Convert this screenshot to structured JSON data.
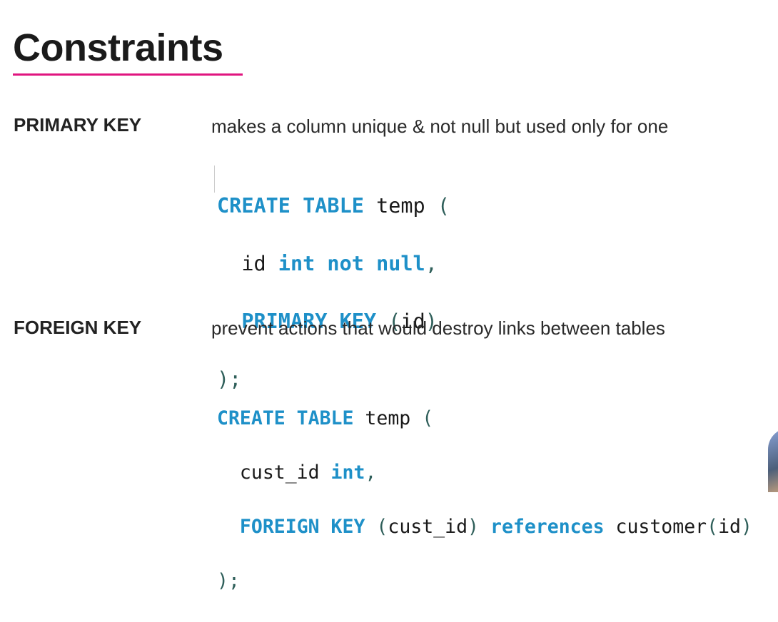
{
  "title": "Constraints",
  "accent_color": "#e0157f",
  "sections": [
    {
      "label": "PRIMARY KEY",
      "description": "makes a column unique & not null but used only for one",
      "code": {
        "l1": {
          "kw": "CREATE TABLE",
          "name": " temp ",
          "p": "("
        },
        "l2": {
          "a": "  id ",
          "kw": "int not null",
          "c": ","
        },
        "l3": {
          "a": "  ",
          "kw": "PRIMARY KEY",
          "b": " ",
          "p1": "(",
          "c": "id",
          "p2": ")"
        },
        "l4": {
          "p": ");"
        }
      }
    },
    {
      "label": "FOREIGN KEY",
      "description": "prevent actions that would destroy links between tables",
      "code": {
        "l1": {
          "kw": "CREATE TABLE",
          "name": " temp ",
          "p": "("
        },
        "l2": {
          "a": "  cust_id ",
          "kw": "int",
          "c": ","
        },
        "l3": {
          "a": "  ",
          "kw": "FOREIGN KEY",
          "b": " ",
          "p1": "(",
          "c": "cust_id",
          "p2": ")",
          "d": " ",
          "kw2": "references",
          "e": " customer",
          "p3": "(",
          "f": "id",
          "p4": ")"
        },
        "l4": {
          "p": ");"
        }
      }
    }
  ]
}
